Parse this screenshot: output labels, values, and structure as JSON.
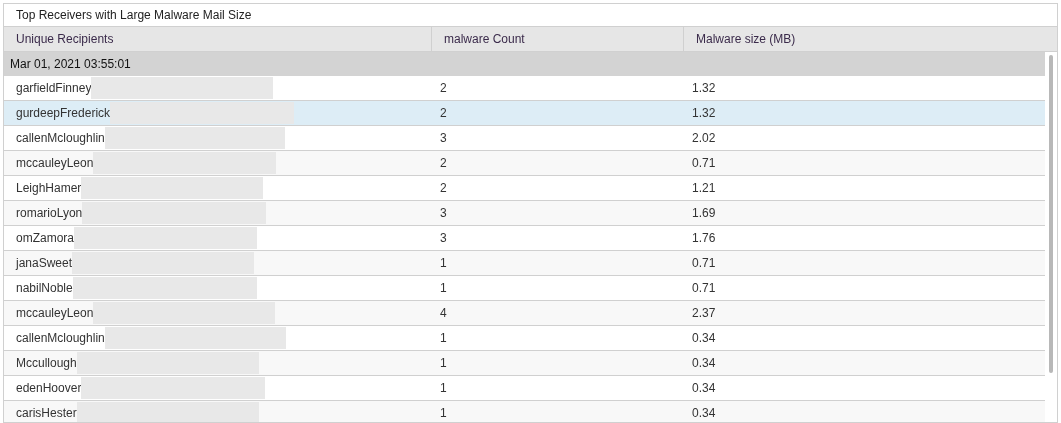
{
  "panel": {
    "title": "Top Receivers with Large Malware Mail Size"
  },
  "table": {
    "columns": [
      "Unique Recipients",
      "malware Count",
      "Malware size (MB)"
    ],
    "group": "Mar 01, 2021 03:55:01",
    "rows": [
      {
        "recipient": "garfieldFinney",
        "count": "2",
        "size": "1.32",
        "selected": false
      },
      {
        "recipient": "gurdeepFrederick",
        "count": "2",
        "size": "1.32",
        "selected": true
      },
      {
        "recipient": "callenMcloughlin",
        "count": "3",
        "size": "2.02",
        "selected": false
      },
      {
        "recipient": "mccauleyLeon",
        "count": "2",
        "size": "0.71",
        "selected": false
      },
      {
        "recipient": "LeighHamer",
        "count": "2",
        "size": "1.21",
        "selected": false
      },
      {
        "recipient": "romarioLyon",
        "count": "3",
        "size": "1.69",
        "selected": false
      },
      {
        "recipient": "omZamora",
        "count": "3",
        "size": "1.76",
        "selected": false
      },
      {
        "recipient": "janaSweet",
        "count": "1",
        "size": "0.71",
        "selected": false
      },
      {
        "recipient": "nabilNoble",
        "count": "1",
        "size": "0.71",
        "selected": false
      },
      {
        "recipient": "mccauleyLeon",
        "count": "4",
        "size": "2.37",
        "selected": false
      },
      {
        "recipient": "callenMcloughlin",
        "count": "1",
        "size": "0.34",
        "selected": false
      },
      {
        "recipient": "Mccullough",
        "count": "1",
        "size": "0.34",
        "selected": false
      },
      {
        "recipient": "edenHoover",
        "count": "1",
        "size": "0.34",
        "selected": false
      },
      {
        "recipient": "carisHester",
        "count": "1",
        "size": "0.34",
        "selected": false
      }
    ]
  }
}
